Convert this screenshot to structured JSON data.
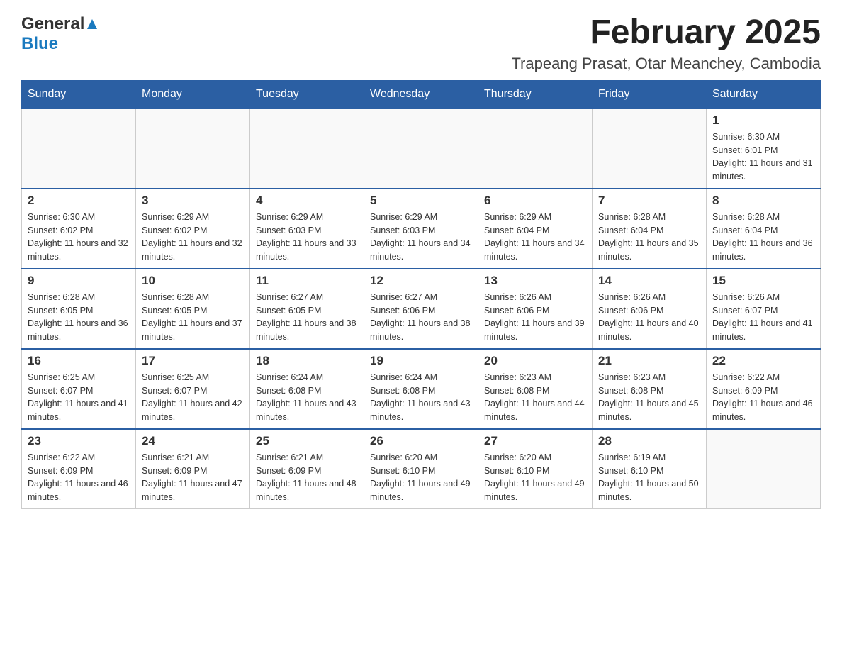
{
  "header": {
    "logo_general": "General",
    "logo_blue": "Blue",
    "main_title": "February 2025",
    "subtitle": "Trapeang Prasat, Otar Meanchey, Cambodia"
  },
  "calendar": {
    "days_of_week": [
      "Sunday",
      "Monday",
      "Tuesday",
      "Wednesday",
      "Thursday",
      "Friday",
      "Saturday"
    ],
    "weeks": [
      {
        "cells": [
          {
            "day": "",
            "info": ""
          },
          {
            "day": "",
            "info": ""
          },
          {
            "day": "",
            "info": ""
          },
          {
            "day": "",
            "info": ""
          },
          {
            "day": "",
            "info": ""
          },
          {
            "day": "",
            "info": ""
          },
          {
            "day": "1",
            "info": "Sunrise: 6:30 AM\nSunset: 6:01 PM\nDaylight: 11 hours and 31 minutes."
          }
        ]
      },
      {
        "cells": [
          {
            "day": "2",
            "info": "Sunrise: 6:30 AM\nSunset: 6:02 PM\nDaylight: 11 hours and 32 minutes."
          },
          {
            "day": "3",
            "info": "Sunrise: 6:29 AM\nSunset: 6:02 PM\nDaylight: 11 hours and 32 minutes."
          },
          {
            "day": "4",
            "info": "Sunrise: 6:29 AM\nSunset: 6:03 PM\nDaylight: 11 hours and 33 minutes."
          },
          {
            "day": "5",
            "info": "Sunrise: 6:29 AM\nSunset: 6:03 PM\nDaylight: 11 hours and 34 minutes."
          },
          {
            "day": "6",
            "info": "Sunrise: 6:29 AM\nSunset: 6:04 PM\nDaylight: 11 hours and 34 minutes."
          },
          {
            "day": "7",
            "info": "Sunrise: 6:28 AM\nSunset: 6:04 PM\nDaylight: 11 hours and 35 minutes."
          },
          {
            "day": "8",
            "info": "Sunrise: 6:28 AM\nSunset: 6:04 PM\nDaylight: 11 hours and 36 minutes."
          }
        ]
      },
      {
        "cells": [
          {
            "day": "9",
            "info": "Sunrise: 6:28 AM\nSunset: 6:05 PM\nDaylight: 11 hours and 36 minutes."
          },
          {
            "day": "10",
            "info": "Sunrise: 6:28 AM\nSunset: 6:05 PM\nDaylight: 11 hours and 37 minutes."
          },
          {
            "day": "11",
            "info": "Sunrise: 6:27 AM\nSunset: 6:05 PM\nDaylight: 11 hours and 38 minutes."
          },
          {
            "day": "12",
            "info": "Sunrise: 6:27 AM\nSunset: 6:06 PM\nDaylight: 11 hours and 38 minutes."
          },
          {
            "day": "13",
            "info": "Sunrise: 6:26 AM\nSunset: 6:06 PM\nDaylight: 11 hours and 39 minutes."
          },
          {
            "day": "14",
            "info": "Sunrise: 6:26 AM\nSunset: 6:06 PM\nDaylight: 11 hours and 40 minutes."
          },
          {
            "day": "15",
            "info": "Sunrise: 6:26 AM\nSunset: 6:07 PM\nDaylight: 11 hours and 41 minutes."
          }
        ]
      },
      {
        "cells": [
          {
            "day": "16",
            "info": "Sunrise: 6:25 AM\nSunset: 6:07 PM\nDaylight: 11 hours and 41 minutes."
          },
          {
            "day": "17",
            "info": "Sunrise: 6:25 AM\nSunset: 6:07 PM\nDaylight: 11 hours and 42 minutes."
          },
          {
            "day": "18",
            "info": "Sunrise: 6:24 AM\nSunset: 6:08 PM\nDaylight: 11 hours and 43 minutes."
          },
          {
            "day": "19",
            "info": "Sunrise: 6:24 AM\nSunset: 6:08 PM\nDaylight: 11 hours and 43 minutes."
          },
          {
            "day": "20",
            "info": "Sunrise: 6:23 AM\nSunset: 6:08 PM\nDaylight: 11 hours and 44 minutes."
          },
          {
            "day": "21",
            "info": "Sunrise: 6:23 AM\nSunset: 6:08 PM\nDaylight: 11 hours and 45 minutes."
          },
          {
            "day": "22",
            "info": "Sunrise: 6:22 AM\nSunset: 6:09 PM\nDaylight: 11 hours and 46 minutes."
          }
        ]
      },
      {
        "cells": [
          {
            "day": "23",
            "info": "Sunrise: 6:22 AM\nSunset: 6:09 PM\nDaylight: 11 hours and 46 minutes."
          },
          {
            "day": "24",
            "info": "Sunrise: 6:21 AM\nSunset: 6:09 PM\nDaylight: 11 hours and 47 minutes."
          },
          {
            "day": "25",
            "info": "Sunrise: 6:21 AM\nSunset: 6:09 PM\nDaylight: 11 hours and 48 minutes."
          },
          {
            "day": "26",
            "info": "Sunrise: 6:20 AM\nSunset: 6:10 PM\nDaylight: 11 hours and 49 minutes."
          },
          {
            "day": "27",
            "info": "Sunrise: 6:20 AM\nSunset: 6:10 PM\nDaylight: 11 hours and 49 minutes."
          },
          {
            "day": "28",
            "info": "Sunrise: 6:19 AM\nSunset: 6:10 PM\nDaylight: 11 hours and 50 minutes."
          },
          {
            "day": "",
            "info": ""
          }
        ]
      }
    ]
  }
}
